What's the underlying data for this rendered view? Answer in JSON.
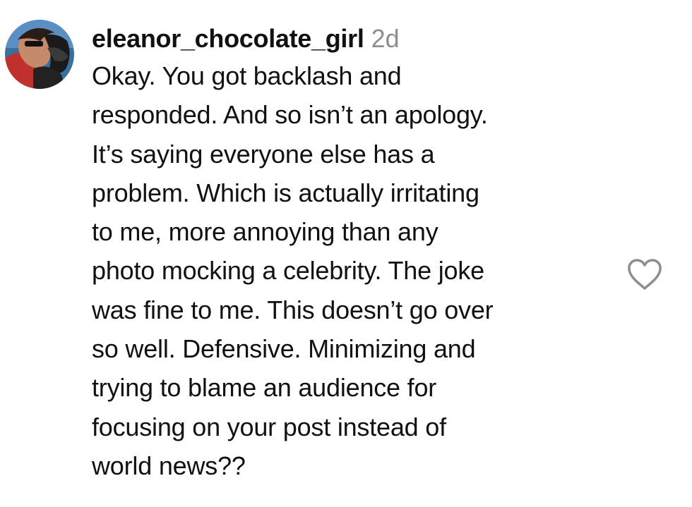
{
  "comment": {
    "username": "eleanor_chocolate_girl",
    "timestamp": "2d",
    "lines": [
      "Okay. You got backlash and",
      "responded. And so isn’t an apology.",
      "It’s saying everyone else has a",
      "problem. Which is actually irritating",
      "to me, more annoying than any",
      "photo mocking a celebrity. The joke",
      "was fine to me. This doesn’t go over",
      "so well. Defensive. Minimizing and",
      "trying to blame an audience for",
      "focusing on your post instead of",
      "world news??"
    ],
    "avatar_icon": "profile-photo",
    "like_icon": "heart-outline-icon",
    "colors": {
      "text": "#111111",
      "timestamp": "#8e8e8e",
      "icon": "#8e8e8e",
      "background": "#ffffff"
    }
  }
}
